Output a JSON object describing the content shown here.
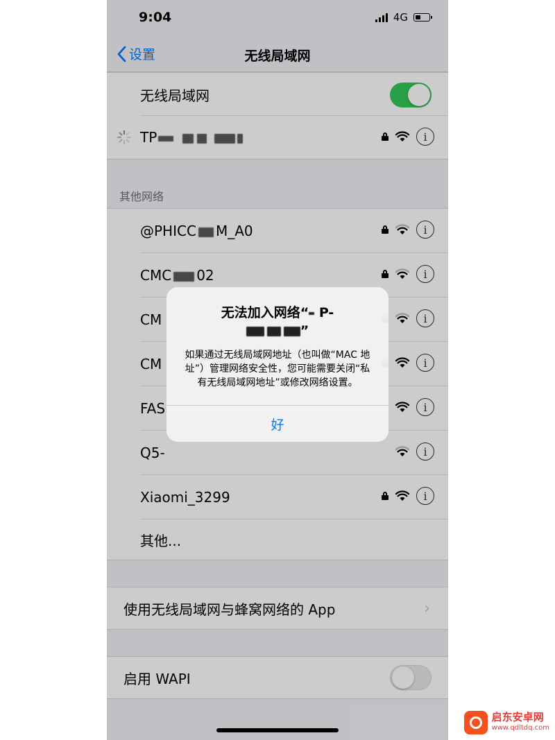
{
  "status": {
    "time": "9:04",
    "network": "4G"
  },
  "navbar": {
    "back_label": "设置",
    "title": "无线局域网"
  },
  "wifi_toggle": {
    "label": "无线局域网",
    "state": "on"
  },
  "connected": {
    "name_prefix": "TP"
  },
  "section_other": {
    "header": "其他网络"
  },
  "networks": [
    {
      "name": "@PHICC",
      "name2": "M_A0",
      "locked": true
    },
    {
      "name": "CMC",
      "name2": "02",
      "locked": true
    },
    {
      "name": "CM",
      "name2": "",
      "locked": true
    },
    {
      "name": "CM",
      "name2": "",
      "locked": true
    },
    {
      "name": "FAS",
      "name2": "",
      "locked": false
    },
    {
      "name": "Q5-",
      "name2": "",
      "locked": false
    },
    {
      "name": "Xiaomi_3299",
      "name2": "",
      "locked": true
    }
  ],
  "other_item": {
    "label": "其他..."
  },
  "apps_row": {
    "label": "使用无线局域网与蜂窝网络的 App"
  },
  "wapi": {
    "label": "启用 WAPI",
    "state": "off"
  },
  "alert": {
    "title_line1": "无法加入网络“",
    "title_frag1": "P-",
    "title_line2_end": "”",
    "message": "如果通过无线局域网地址（也叫做“MAC 地址”）管理网络安全性，您可能需要关闭“私有无线局域网地址”或修改网络设置。",
    "button": "好"
  },
  "watermark": {
    "name": "启东安卓网",
    "url": "www.qdltdq.com"
  },
  "colors": {
    "accent": "#007aff",
    "toggle_on": "#34c759",
    "background": "#f2f2f7"
  },
  "icons": [
    "chevron-left-icon",
    "lock-icon",
    "wifi-icon",
    "info-icon",
    "spinner-icon",
    "chevron-right-icon"
  ]
}
